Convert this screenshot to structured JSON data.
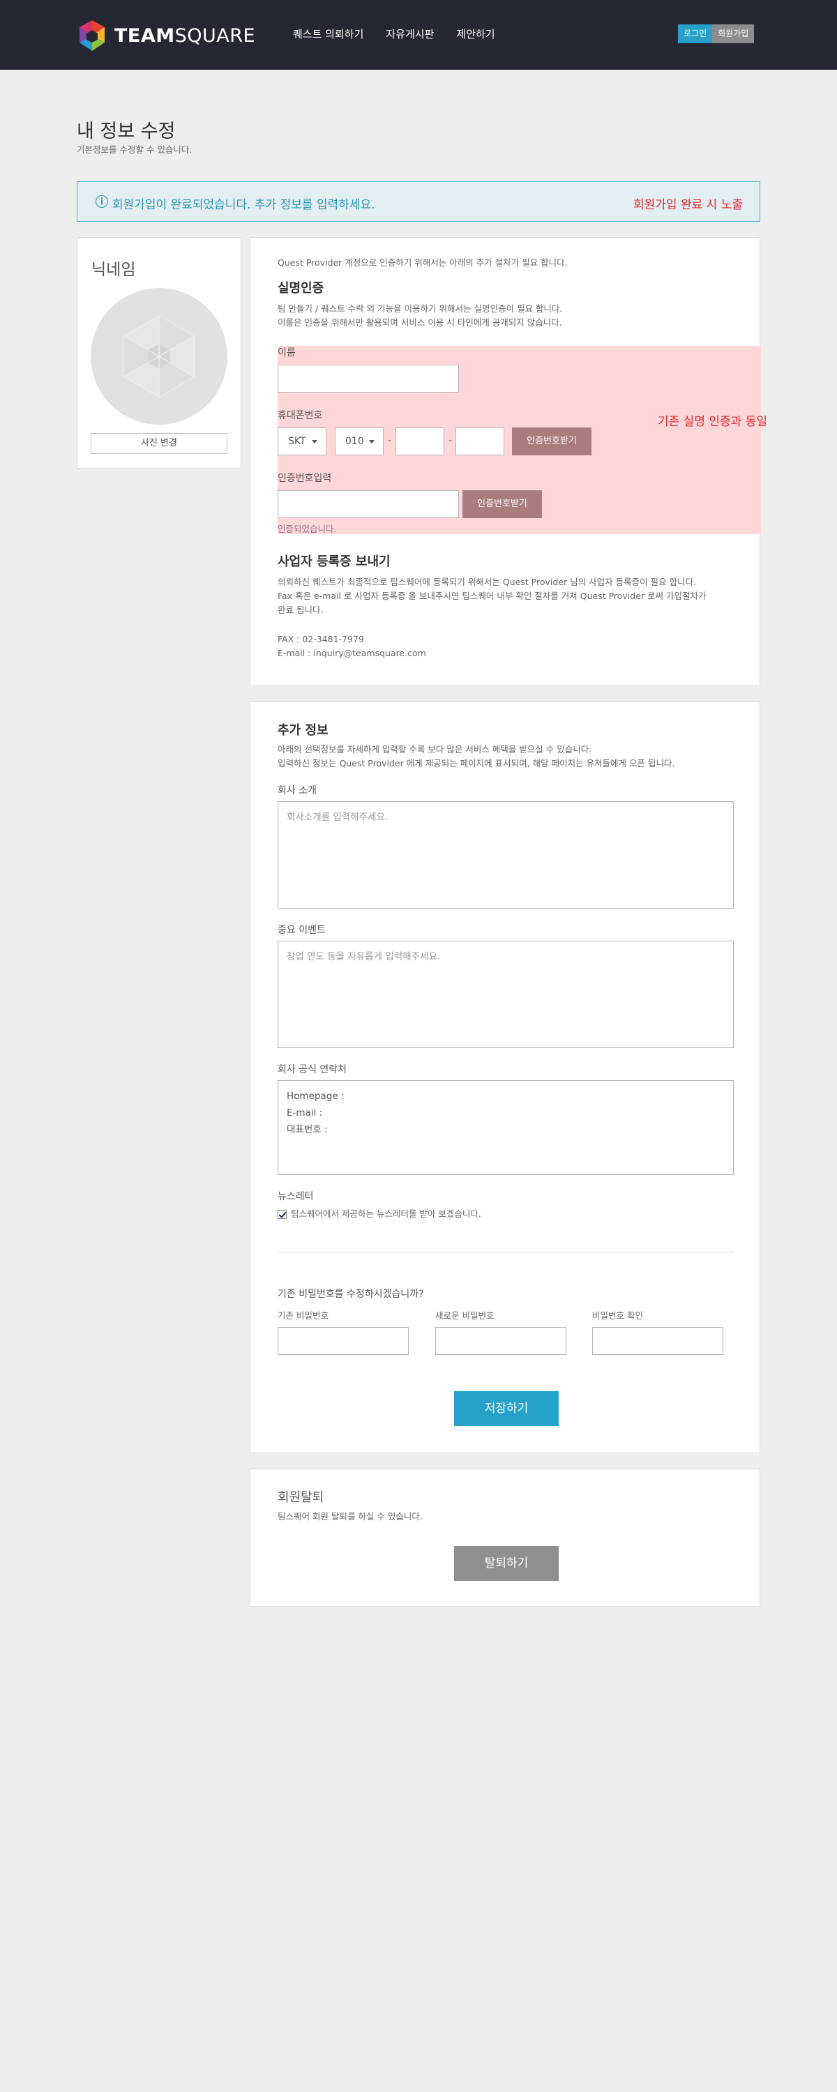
{
  "header": {
    "logo_bold": "TEAM",
    "logo_light": "SQUARE",
    "nav": [
      "퀘스트 의뢰하기",
      "자유게시판",
      "제안하기"
    ],
    "login": "로그인",
    "join": "회원가입"
  },
  "page": {
    "title": "내 정보 수정",
    "subtitle": "기본정보를 수정할 수 있습니다."
  },
  "notice": {
    "icon": "info-icon",
    "text": "회원가입이 완료되었습니다. 추가 정보를 입력하세요.",
    "note": "회원가입 완료 시 노출"
  },
  "profile": {
    "nickname": "닉네임",
    "photo_button": "사진 변경"
  },
  "verify": {
    "intro": "Quest Provider 계정으로 인증하기 위해서는 아래의 추가 절차가 필요 합니다.",
    "title": "실명인증",
    "desc1": "팀 만들기 / 퀘스트 수락 외 기능을 이용하기 위해서는 실명인증이 필요 합니다.",
    "desc2": "이름은 인증을 위해서만 활용되며 서비스 이용 시 타인에게 공개되지 않습니다.",
    "name_label": "이름",
    "phone_label": "휴대폰번호",
    "carrier": "SKT",
    "prefix": "010",
    "dash": "-",
    "get_code": "인증번호받기",
    "code_label": "인증번호입력",
    "code_button": "인증번호받기",
    "verified": "인증되었습니다.",
    "note": "기존 실명 인증과 동일"
  },
  "business": {
    "title": "사업자 등록증 보내기",
    "desc1": "의뢰하신 퀘스트가 최종적으로 팀스퀘어에 등록되기 위해서는 Quest Provider 님의 사업자 등록증이 필요 합니다.",
    "desc2": "Fax 혹은 e-mail 로 사업자 등록증 을 보내주시면 팀스퀘어 내부 확인 절차를 거쳐 Quest Provider 로써 가입절차가",
    "desc3": "완료 됩니다.",
    "fax": "FAX :   02-3481-7979",
    "email": "E-mail :   inquiry@teamsquare.com"
  },
  "extra": {
    "title": "추가 정보",
    "desc1": "아래의 선택정보를 자세하게 입력할 수록 보다 많은 서비스 혜택을 받으실 수 있습니다.",
    "desc2": "입력하신 정보는 Quest Provider 에게 제공되는 페이지에 표시되며, 해당 페이지는 유저들에게 오픈 됩니다.",
    "company_label": "회사 소개",
    "company_placeholder": "회사소개를 입력해주세요.",
    "event_label": "중요 이벤트",
    "event_placeholder": "창업 연도 등을 자유롭게 입력해주세요.",
    "contact_label": "회사 공식 연락처",
    "contact_homepage": "Homepage :",
    "contact_email": "E-mail :",
    "contact_phone": "대표번호 :",
    "newsletter_label": "뉴스레터",
    "newsletter_check": "팀스퀘어에서 제공하는 뉴스레터를 받아 보겠습니다.",
    "pw_question": "기존 비밀번호를 수정하시겠습니까?",
    "pw_current": "기존 비밀번호",
    "pw_new": "새로운 비밀번호",
    "pw_confirm": "비밀번호 확인",
    "save": "저장하기"
  },
  "withdraw": {
    "title": "회원탈퇴",
    "desc": "팀스퀘어 회원 탈퇴를 하실 수 있습니다.",
    "button": "탈퇴하기"
  }
}
